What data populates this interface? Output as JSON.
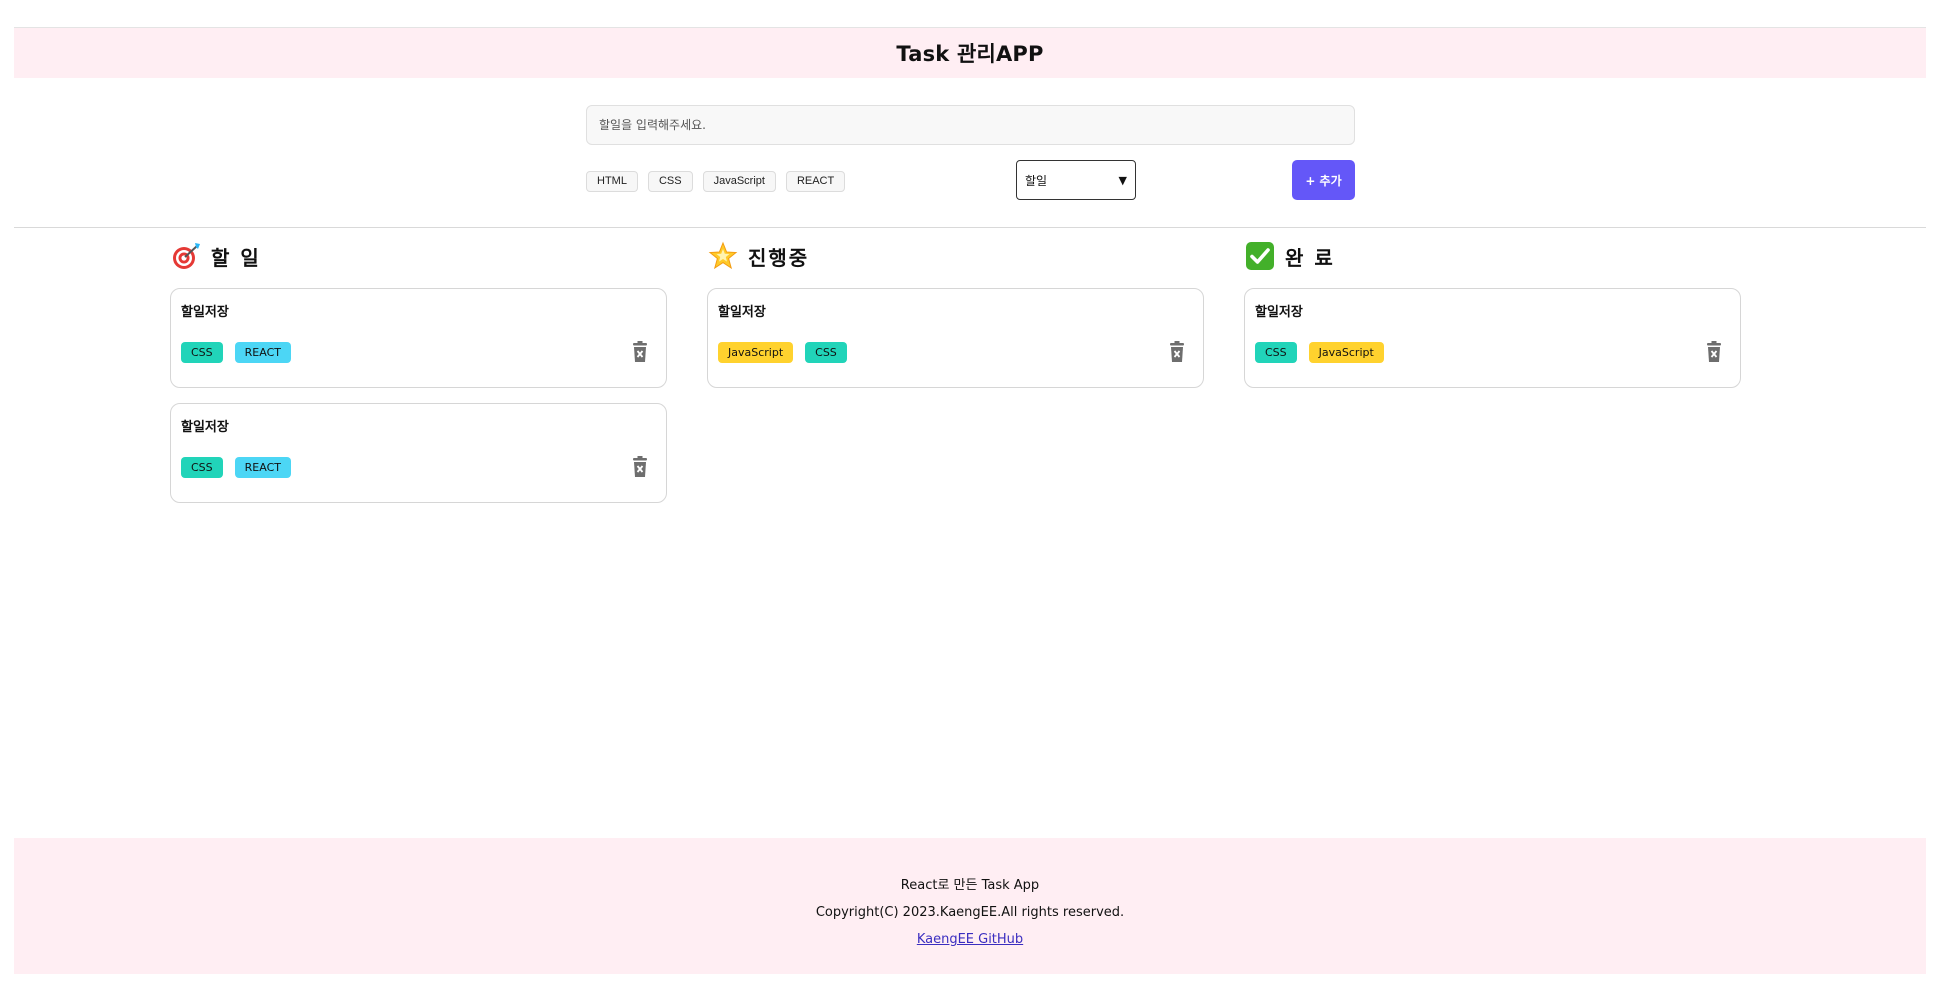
{
  "header": {
    "title": "Task 관리APP"
  },
  "form": {
    "input_placeholder": "할일을 입력해주세요.",
    "tags": [
      "HTML",
      "CSS",
      "JavaScript",
      "REACT"
    ],
    "status_value": "할일",
    "add_label": "+ 추가"
  },
  "colors": {
    "accent": "#6457f8",
    "header_bg": "#ffeef3",
    "tag_css": "#21d4b9",
    "tag_react": "#4cd6f5",
    "tag_js": "#ffd22e"
  },
  "columns": [
    {
      "icon": "dart-target-icon",
      "title": "할 일",
      "cards": [
        {
          "title": "할일저장",
          "tags": [
            "CSS",
            "REACT"
          ]
        },
        {
          "title": "할일저장",
          "tags": [
            "CSS",
            "REACT"
          ]
        }
      ]
    },
    {
      "icon": "glowing-star-icon",
      "title": "진행중",
      "cards": [
        {
          "title": "할일저장",
          "tags": [
            "JavaScript",
            "CSS"
          ]
        }
      ]
    },
    {
      "icon": "check-mark-button-icon",
      "title": "완 료",
      "cards": [
        {
          "title": "할일저장",
          "tags": [
            "CSS",
            "JavaScript"
          ]
        }
      ]
    }
  ],
  "footer": {
    "line1": "React로 만든 Task App",
    "line2": "Copyright(C) 2023.KaengEE.All rights reserved.",
    "link": "KaengEE GitHub"
  }
}
